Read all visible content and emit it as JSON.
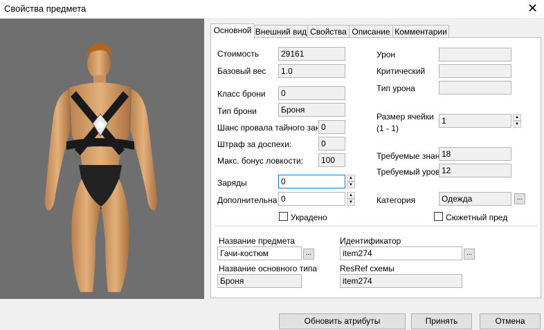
{
  "window": {
    "title": "Свойства предмета",
    "close_glyph": "✕"
  },
  "tabs": [
    "Основной",
    "Внешний вид",
    "Свойства",
    "Описание",
    "Комментарии"
  ],
  "labels": {
    "cost": "Стоимость",
    "base_weight": "Базовый вес",
    "armor_class": "Класс брони",
    "armor_type": "Тип брони",
    "spell_failure": "Шанс провала тайного закл",
    "armor_penalty": "Штраф за доспехи:",
    "max_dex": "Макс. бонус ловкости:",
    "charges": "Заряды",
    "additional": "Дополнительная",
    "damage": "Урон",
    "critical": "Критический",
    "damage_type": "Тип урона",
    "cell_size_1": "Размер ячейки",
    "cell_size_2": "(1 - 1)",
    "req_skill": "Требуемые знани",
    "req_level": "Требуемый урове",
    "category": "Категория",
    "stolen": "Украдено",
    "plot": "Сюжетный пред",
    "item_name": "Название предмета",
    "identifier": "Идентификатор",
    "base_type_name": "Название основного типа",
    "resref": "ResRef схемы"
  },
  "values": {
    "cost": "29161",
    "base_weight": "1.0",
    "armor_class": "0",
    "armor_type": "Броня",
    "spell_failure": "0",
    "armor_penalty": "0",
    "max_dex": "100",
    "charges": "0",
    "additional": "0",
    "damage": "",
    "critical": "",
    "damage_type": "",
    "cell_size": "1",
    "req_skill": "18",
    "req_level": "12",
    "category": "Одежда",
    "item_name": "Гачи-костюм",
    "identifier": "item274",
    "base_type_name": "Броня",
    "resref": "item274"
  },
  "checkboxes": {
    "stolen": false,
    "plot": false
  },
  "icons": {
    "spin_up": "▲",
    "spin_down": "▼",
    "browse": "..."
  },
  "buttons": {
    "update": "Обновить атрибуты",
    "accept": "Принять",
    "cancel": "Отмена"
  },
  "colors": {
    "preview_bg": "#6f6f6f",
    "focus_border": "#0078d7"
  }
}
